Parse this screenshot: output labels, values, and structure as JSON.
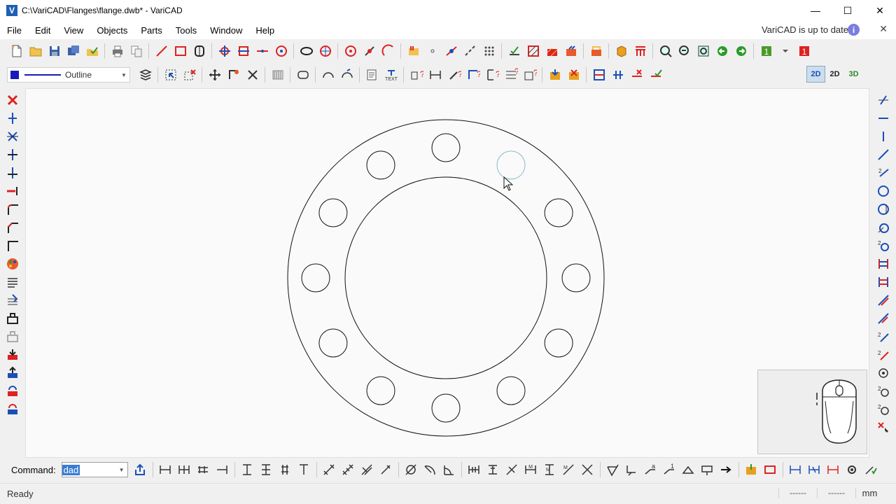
{
  "window": {
    "title": "C:\\VariCAD\\Flanges\\flange.dwb* - VariCAD",
    "app_icon_letter": "V",
    "controls": [
      "—",
      "☐",
      "✕"
    ]
  },
  "menu": {
    "items": [
      "File",
      "Edit",
      "View",
      "Objects",
      "Parts",
      "Tools",
      "Window",
      "Help"
    ],
    "update_notice": "VariCAD is up to date",
    "info_icon": "i",
    "close_icon": "✕"
  },
  "line_style": {
    "color": "#1a1ab8",
    "name": "Outline"
  },
  "view_modes": [
    "2D",
    "2D",
    "3D"
  ],
  "command": {
    "label": "Command:",
    "value": "dad"
  },
  "status": {
    "text": "Ready",
    "field1": "------",
    "field2": "------",
    "unit": "mm"
  },
  "colors": {
    "accent": "#1e5fb4",
    "delete_red": "#e02020",
    "tool_blue": "#1a4fb8"
  }
}
